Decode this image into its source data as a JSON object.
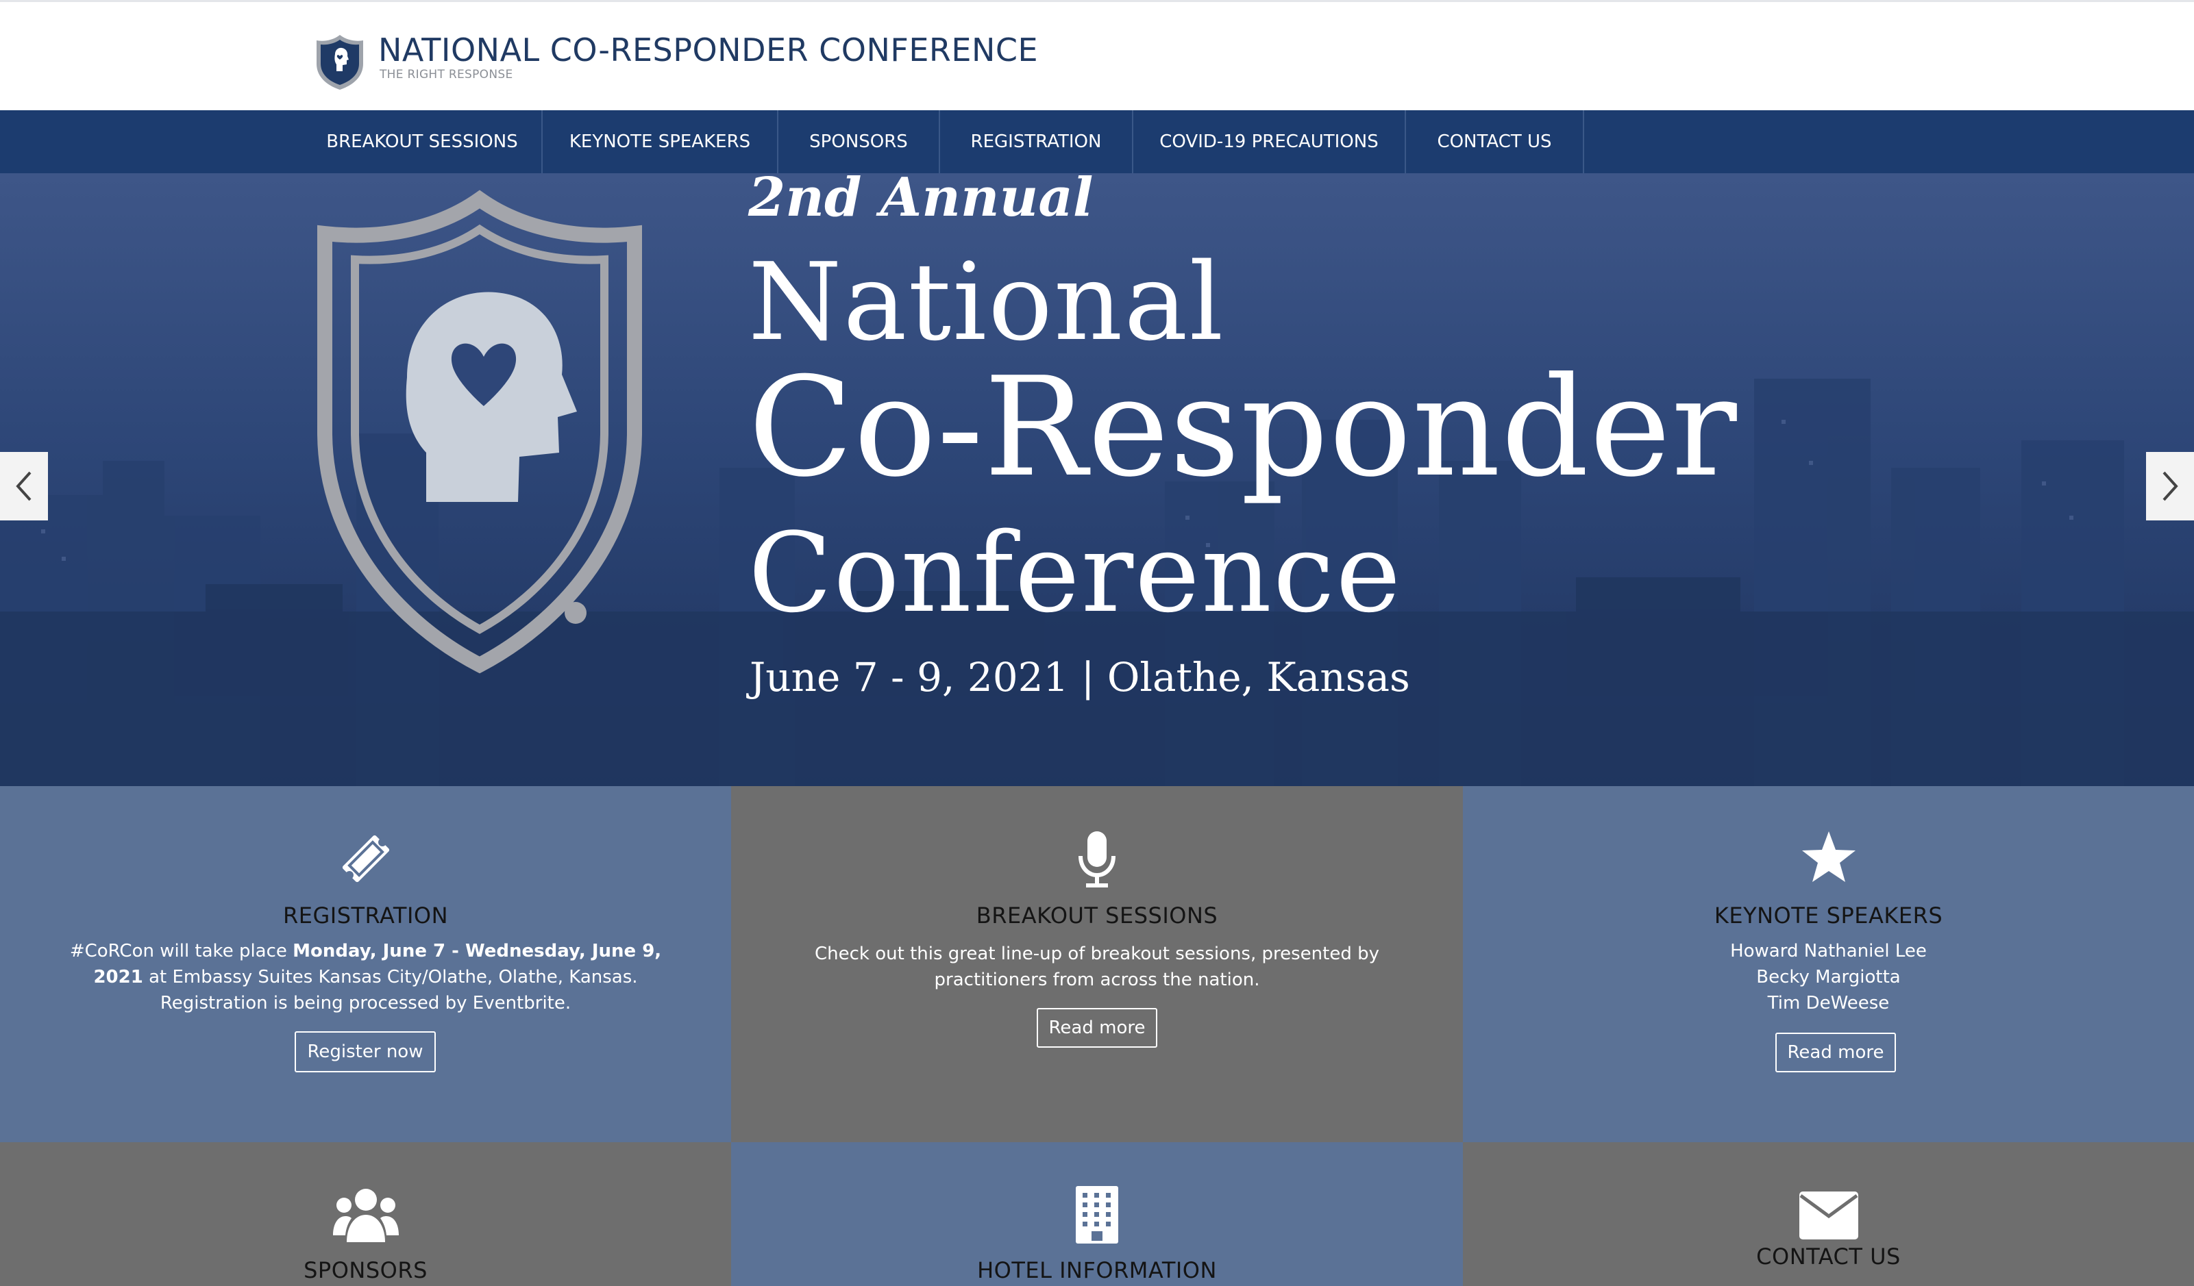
{
  "header": {
    "title": "NATIONAL CO-RESPONDER CONFERENCE",
    "tagline": "THE RIGHT RESPONSE"
  },
  "nav": {
    "items": [
      {
        "label": "BREAKOUT SESSIONS"
      },
      {
        "label": "KEYNOTE SPEAKERS"
      },
      {
        "label": "SPONSORS"
      },
      {
        "label": "REGISTRATION"
      },
      {
        "label": "COVID-19 PRECAUTIONS"
      },
      {
        "label": "CONTACT US"
      }
    ]
  },
  "hero": {
    "annual": "2nd Annual",
    "line1": "National",
    "line2": "Co-Responder",
    "line3": "Conference",
    "date_place": "June 7 - 9, 2021 | Olathe, Kansas"
  },
  "colors": {
    "brand_navy": "#1c3c6f",
    "tile_blue": "#5b7296",
    "tile_gray": "#6e6e6e"
  },
  "tiles": {
    "registration": {
      "icon": "ticket-icon",
      "title": "REGISTRATION",
      "text_pre": "#CoRCon will take place ",
      "text_bold": "Monday, June 7 - Wednesday, June 9, 2021",
      "text_post": " at Embassy Suites Kansas City/Olathe, Olathe, Kansas. Registration is being processed by Eventbrite.",
      "button": "Register now"
    },
    "breakout": {
      "icon": "microphone-icon",
      "title": "BREAKOUT SESSIONS",
      "text": "Check out this great line-up of breakout sessions, presented by practitioners from across the nation.",
      "button": "Read more"
    },
    "keynote": {
      "icon": "star-icon",
      "title": "KEYNOTE SPEAKERS",
      "speakers": [
        "Howard Nathaniel Lee",
        "Becky Margiotta",
        "Tim DeWeese"
      ],
      "button": "Read more"
    },
    "sponsors": {
      "icon": "users-icon",
      "title": "SPONSORS"
    },
    "hotel": {
      "icon": "building-icon",
      "title": "HOTEL INFORMATION"
    },
    "contact": {
      "icon": "envelope-icon",
      "title": "CONTACT US"
    }
  }
}
